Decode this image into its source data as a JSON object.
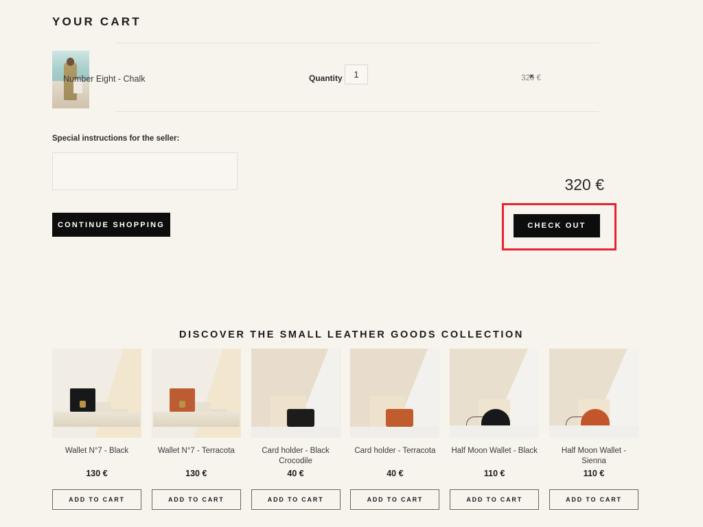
{
  "cart": {
    "title": "YOUR CART",
    "item": {
      "name": "Number Eight - Chalk",
      "quantity_label": "Quantity :",
      "quantity_value": "1",
      "price": "320 €",
      "remove_label": "×",
      "thumbnail_alt": "model-on-beach-photo"
    },
    "instructions_label": "Special instructions for the seller:",
    "instructions_value": "",
    "instructions_placeholder": "",
    "total": "320 €",
    "continue_label": "CONTINUE SHOPPING",
    "checkout_label": "CHECK OUT"
  },
  "highlight": {
    "color": "#e8232f",
    "target": "check-out-button"
  },
  "collection": {
    "title": "DISCOVER THE SMALL LEATHER GOODS COLLECTION",
    "add_to_cart_label": "ADD TO CART",
    "products": [
      {
        "name": "Wallet N°7 - Black",
        "price": "130 €",
        "scene": "a",
        "color": "#17181a"
      },
      {
        "name": "Wallet N°7 - Terracota",
        "price": "130 €",
        "scene": "a",
        "color": "#bd5b32"
      },
      {
        "name": "Card holder - Black Crocodile",
        "price": "40 €",
        "scene": "b",
        "color": "#1d1c1a"
      },
      {
        "name": "Card holder - Terracota",
        "price": "40 €",
        "scene": "b",
        "color": "#c05c2e"
      },
      {
        "name": "Half Moon Wallet - Black",
        "price": "110 €",
        "scene": "c",
        "color": "#17181a"
      },
      {
        "name": "Half Moon Wallet - Sienna",
        "price": "110 €",
        "scene": "c",
        "color": "#c2562a"
      }
    ]
  },
  "theme": {
    "background": "#f7f3ed",
    "button_dark": "#0d0d0d",
    "text": "#2b2b2b"
  }
}
